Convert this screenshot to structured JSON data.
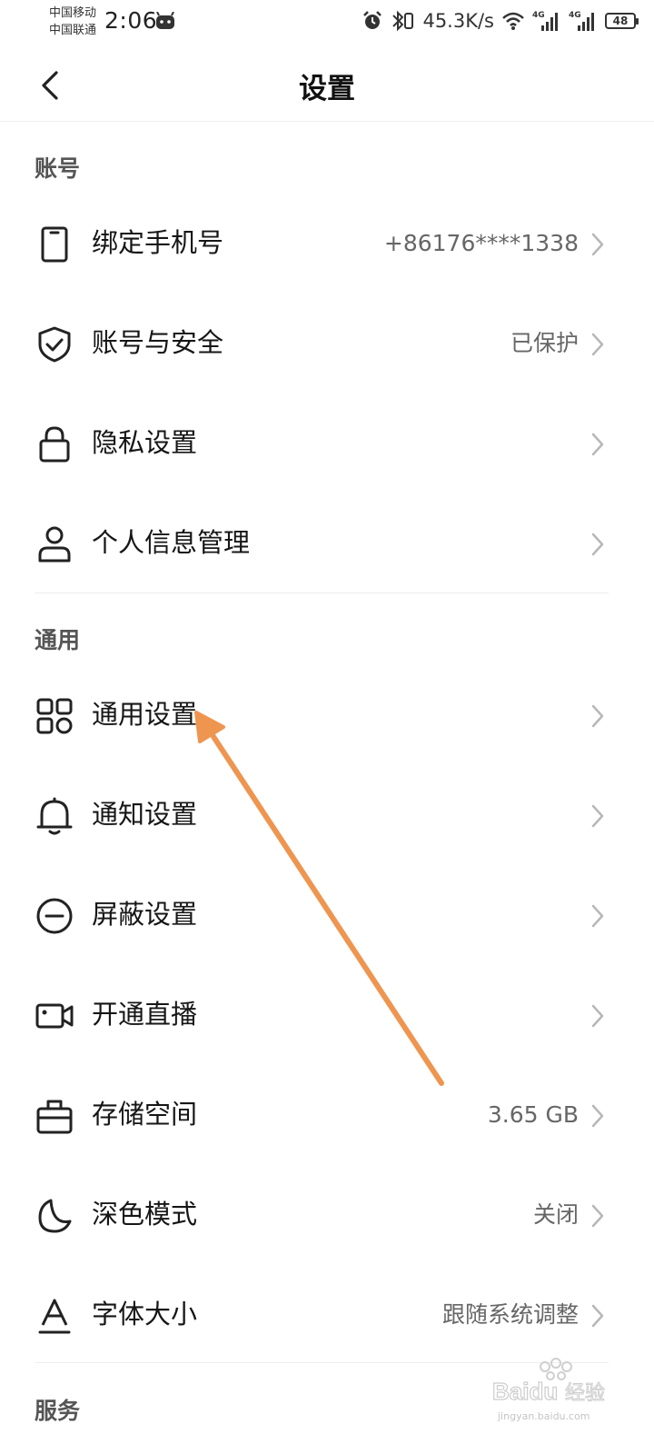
{
  "status_bar": {
    "carrier1": "中国移动",
    "carrier2": "中国联通",
    "time": "2:06",
    "speed": "45.3K/s",
    "network1": "4G",
    "network2": "4G",
    "battery": "48"
  },
  "header": {
    "title": "设置"
  },
  "sections": {
    "account": {
      "title": "账号",
      "items": [
        {
          "label": "绑定手机号",
          "value": "+86176****1338",
          "icon": "phone-icon"
        },
        {
          "label": "账号与安全",
          "value": "已保护",
          "icon": "shield-check-icon"
        },
        {
          "label": "隐私设置",
          "value": "",
          "icon": "lock-icon"
        },
        {
          "label": "个人信息管理",
          "value": "",
          "icon": "person-icon"
        }
      ]
    },
    "general": {
      "title": "通用",
      "items": [
        {
          "label": "通用设置",
          "value": "",
          "icon": "grid-icon"
        },
        {
          "label": "通知设置",
          "value": "",
          "icon": "bell-icon"
        },
        {
          "label": "屏蔽设置",
          "value": "",
          "icon": "block-icon"
        },
        {
          "label": "开通直播",
          "value": "",
          "icon": "video-camera-icon"
        },
        {
          "label": "存储空间",
          "value": "3.65 GB",
          "icon": "storage-icon"
        },
        {
          "label": "深色模式",
          "value": "关闭",
          "icon": "moon-icon"
        },
        {
          "label": "字体大小",
          "value": "跟随系统调整",
          "icon": "font-size-icon"
        }
      ]
    },
    "service": {
      "title": "服务"
    }
  },
  "annotation": {
    "arrow_color": "#ee9550",
    "points_to": "通用设置"
  },
  "watermark": {
    "text": "jingyan.baidu.com"
  }
}
